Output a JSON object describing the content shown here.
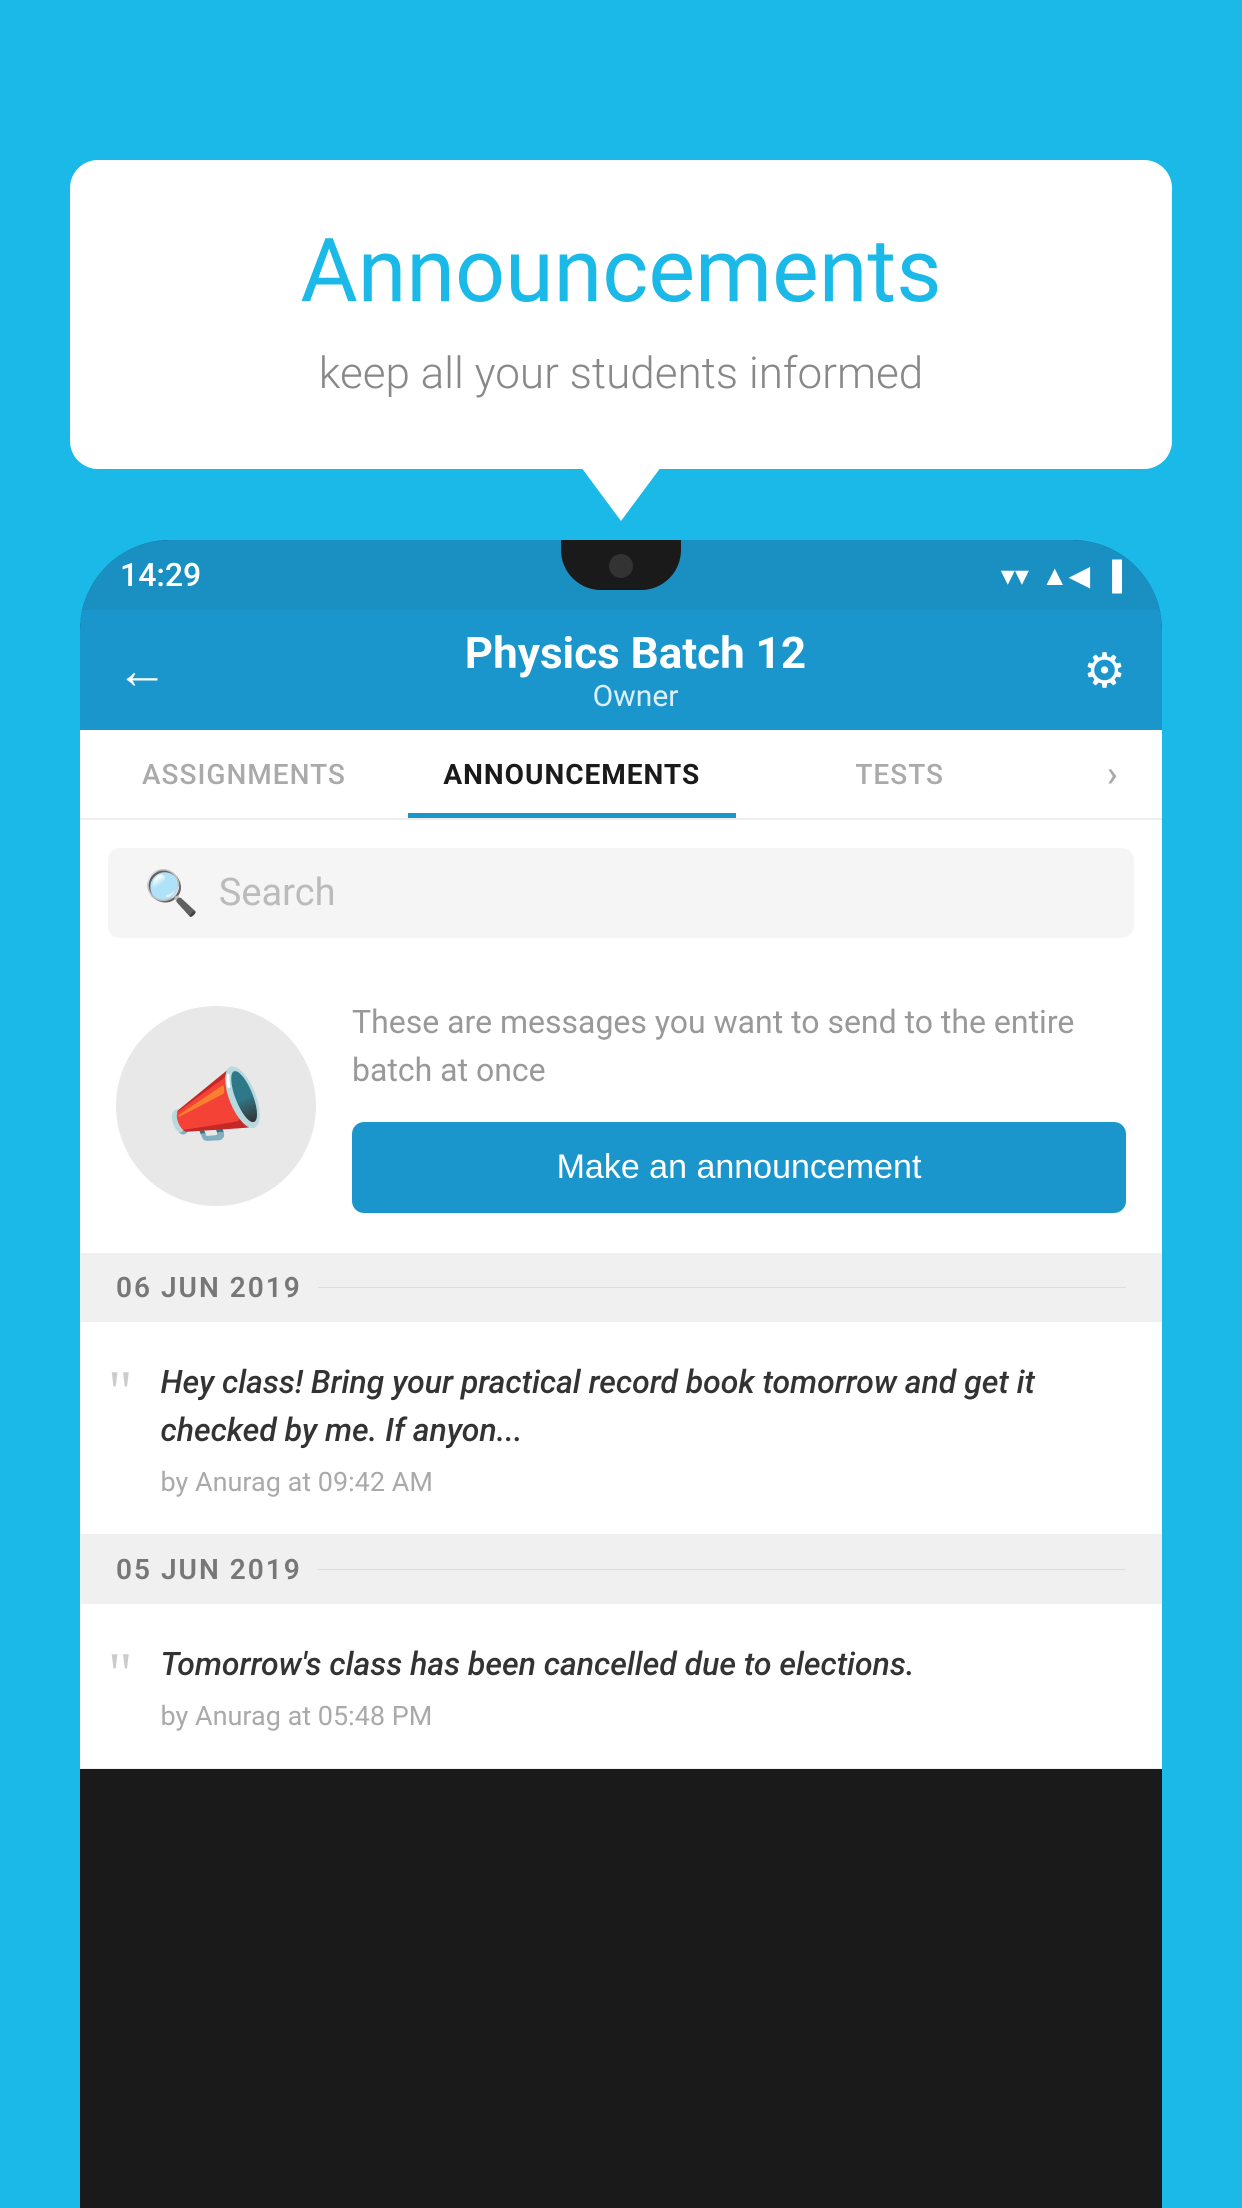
{
  "background_color": "#1ab9e8",
  "speech_bubble": {
    "title": "Announcements",
    "subtitle": "keep all your students informed"
  },
  "phone": {
    "status_bar": {
      "time": "14:29",
      "wifi": "▼",
      "signal": "▲",
      "battery": "▮"
    },
    "app_bar": {
      "title": "Physics Batch 12",
      "subtitle": "Owner",
      "back_label": "←",
      "settings_label": "⚙"
    },
    "tabs": [
      {
        "label": "ASSIGNMENTS",
        "active": false
      },
      {
        "label": "ANNOUNCEMENTS",
        "active": true
      },
      {
        "label": "TESTS",
        "active": false
      },
      {
        "label": "...",
        "active": false
      }
    ],
    "search": {
      "placeholder": "Search"
    },
    "promo": {
      "icon": "📢",
      "description": "These are messages you want to send to the entire batch at once",
      "button_label": "Make an announcement"
    },
    "announcements": [
      {
        "date": "06  JUN  2019",
        "text": "Hey class! Bring your practical record book tomorrow and get it checked by me. If anyon...",
        "meta": "by Anurag at 09:42 AM"
      },
      {
        "date": "05  JUN  2019",
        "text": "Tomorrow's class has been cancelled due to elections.",
        "meta": "by Anurag at 05:48 PM"
      }
    ]
  }
}
